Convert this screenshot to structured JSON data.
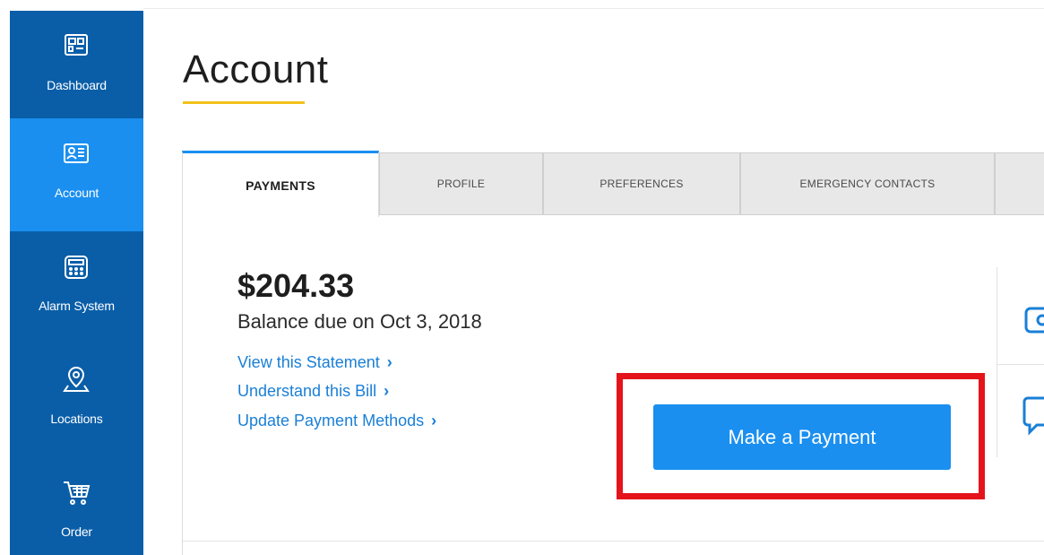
{
  "sidebar": {
    "items": [
      {
        "label": "Dashboard",
        "icon": "dashboard-icon",
        "active": false
      },
      {
        "label": "Account",
        "icon": "account-card-icon",
        "active": true
      },
      {
        "label": "Alarm System",
        "icon": "alarm-panel-icon",
        "active": false
      },
      {
        "label": "Locations",
        "icon": "location-pin-icon",
        "active": false
      },
      {
        "label": "Order",
        "icon": "shopping-cart-icon",
        "active": false
      }
    ]
  },
  "header": {
    "title": "Account"
  },
  "tabs": [
    {
      "label": "PAYMENTS",
      "active": true
    },
    {
      "label": "PROFILE",
      "active": false
    },
    {
      "label": "PREFERENCES",
      "active": false
    },
    {
      "label": "EMERGENCY CONTACTS",
      "active": false
    }
  ],
  "payments": {
    "amount": "$204.33",
    "due_text": "Balance due on Oct 3, 2018",
    "links": [
      {
        "label": "View this Statement"
      },
      {
        "label": "Understand this Bill"
      },
      {
        "label": "Update Payment Methods"
      }
    ],
    "pay_button_label": "Make a Payment"
  },
  "colors": {
    "sidebar": "#0a5ea8",
    "sidebar_active": "#1a8ff0",
    "accent": "#1a8ff0",
    "link": "#1a7fd6",
    "title_underline": "#f2c11b",
    "highlight": "#e5141b"
  }
}
